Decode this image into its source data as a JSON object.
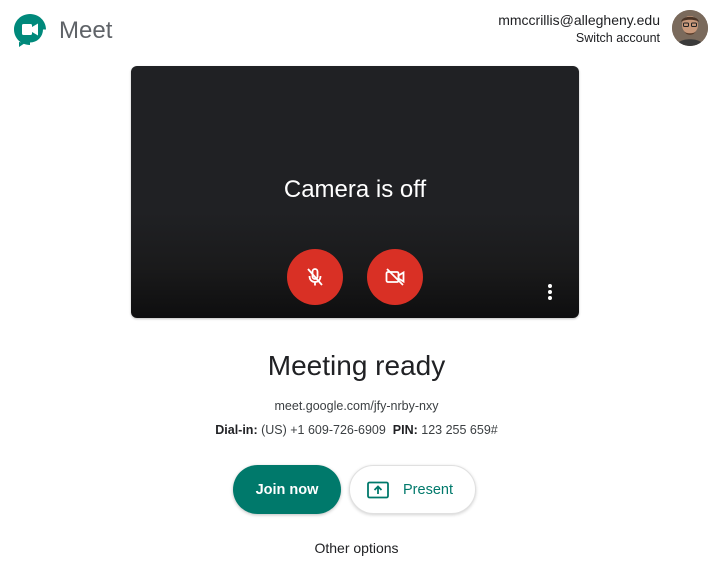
{
  "header": {
    "brand": "Meet",
    "account_email": "mmccrillis@allegheny.edu",
    "switch_account": "Switch account",
    "logo_icon": "google-meet-logo-icon",
    "avatar_icon": "user-avatar"
  },
  "preview": {
    "status_text": "Camera is off",
    "mic_icon": "mic-off-icon",
    "camera_icon": "videocam-off-icon",
    "more_icon": "more-vert-icon"
  },
  "main": {
    "title": "Meeting ready",
    "meeting_link": "meet.google.com/jfy-nrby-nxy",
    "dial_in_label": "Dial-in:",
    "dial_in_number": "(US) +1 609-726-6909",
    "pin_label": "PIN:",
    "pin_value": "123 255 659#",
    "join_label": "Join now",
    "present_label": "Present",
    "other_options": "Other options"
  },
  "colors": {
    "accent": "#00796b",
    "danger": "#d93025",
    "preview_bg": "#202124"
  }
}
